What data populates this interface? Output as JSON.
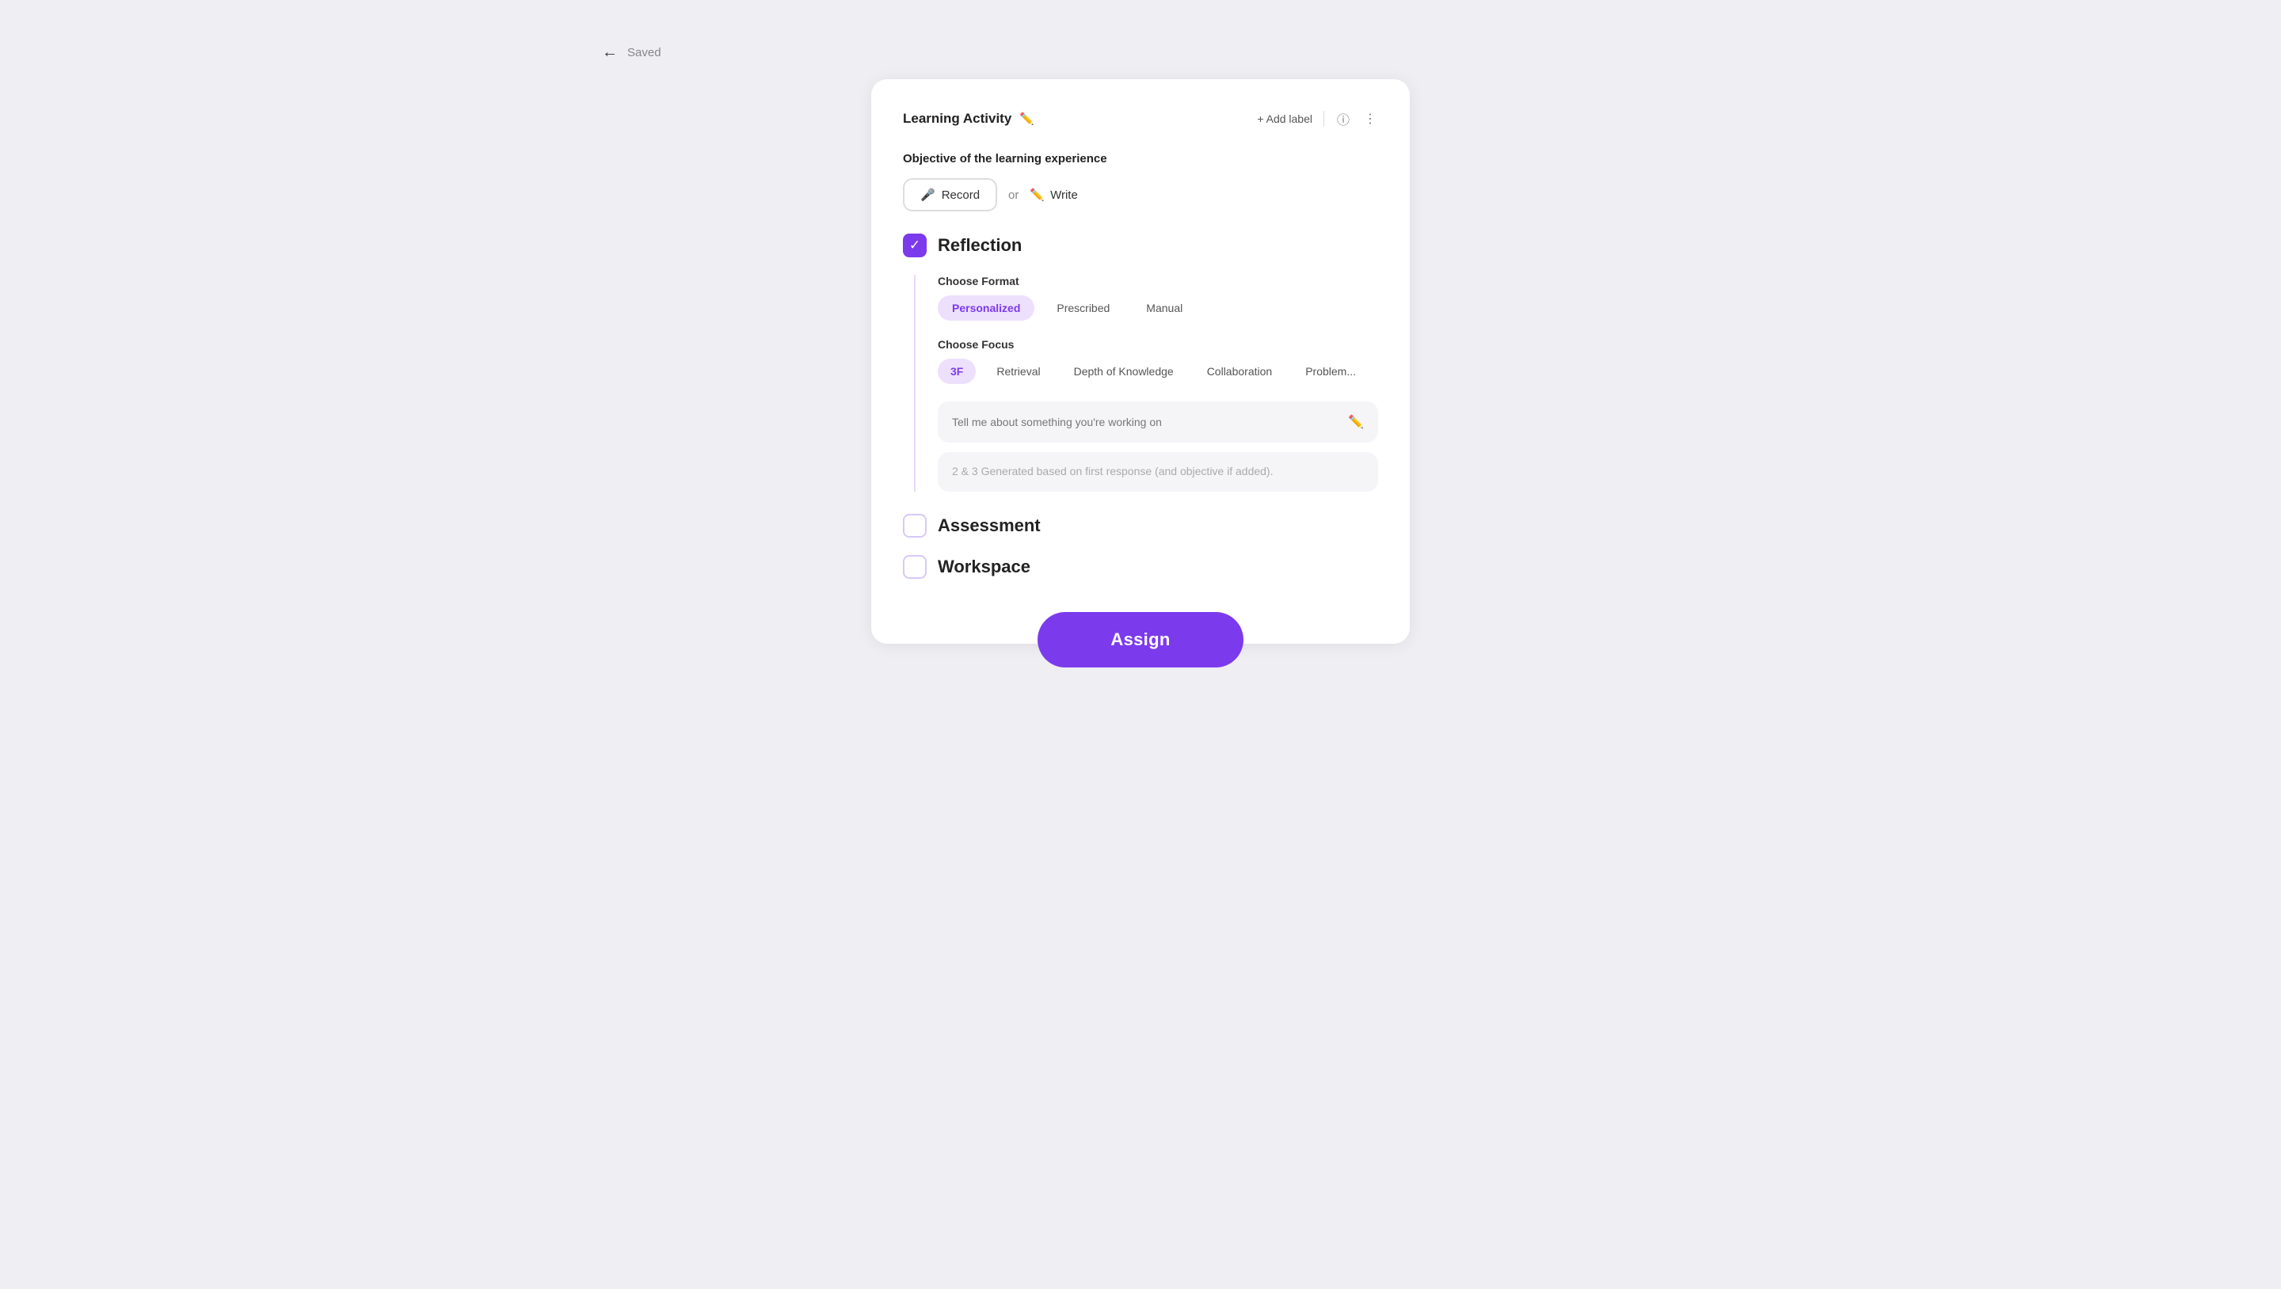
{
  "topbar": {
    "saved_label": "Saved"
  },
  "card": {
    "title": "Learning Activity",
    "add_label": "+ Add label",
    "objective_label": "Objective of the learning experience",
    "record_btn": "Record",
    "or_text": "or",
    "write_btn": "Write",
    "reflection": {
      "title": "Reflection",
      "choose_format_label": "Choose Format",
      "formats": [
        {
          "label": "Personalized",
          "active": true
        },
        {
          "label": "Prescribed",
          "active": false
        },
        {
          "label": "Manual",
          "active": false
        }
      ],
      "choose_focus_label": "Choose Focus",
      "focus_options": [
        {
          "label": "3F",
          "active": true
        },
        {
          "label": "Retrieval",
          "active": false
        },
        {
          "label": "Depth of Knowledge",
          "active": false
        },
        {
          "label": "Collaboration",
          "active": false
        },
        {
          "label": "Problem...",
          "active": false
        }
      ],
      "prompt_placeholder": "Tell me about something you're working on",
      "generated_note": "2 & 3 Generated based on first response (and objective if added)."
    },
    "assessment": {
      "title": "Assessment"
    },
    "workspace": {
      "title": "Workspace"
    },
    "assign_btn": "Assign"
  }
}
